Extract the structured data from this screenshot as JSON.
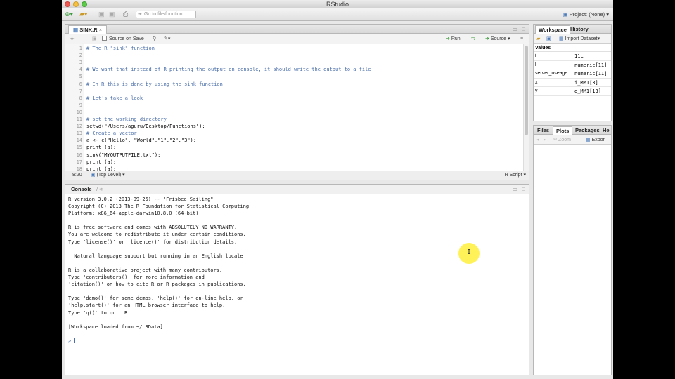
{
  "app": {
    "title": "RStudio",
    "goto_placeholder": "Go to file/function",
    "project_label": "Project: (None)"
  },
  "editor": {
    "tab_label": "SINK.R",
    "source_on_save": "Source on Save",
    "run_label": "Run",
    "source_label": "Source",
    "cursor_pos": "8:20",
    "scope": "(Top Level)",
    "filetype": "R Script",
    "lines": [
      {
        "n": "1",
        "text": "# The R \"sink\" function",
        "kind": "comment"
      },
      {
        "n": "2",
        "text": "",
        "kind": "code"
      },
      {
        "n": "3",
        "text": "",
        "kind": "code"
      },
      {
        "n": "4",
        "text": "# We want that instead of R printing the output on console, it should write the output to a file",
        "kind": "comment"
      },
      {
        "n": "5",
        "text": "",
        "kind": "code"
      },
      {
        "n": "6",
        "text": "# In R this is done by using the sink function",
        "kind": "comment"
      },
      {
        "n": "7",
        "text": "",
        "kind": "code"
      },
      {
        "n": "8",
        "text": "# Let's take a look",
        "kind": "comment",
        "cursor": true
      },
      {
        "n": "9",
        "text": "",
        "kind": "code"
      },
      {
        "n": "10",
        "text": "",
        "kind": "code"
      },
      {
        "n": "11",
        "text": "# set the working directory",
        "kind": "comment"
      },
      {
        "n": "12",
        "text": "setwd(\"/Users/aguru/Desktop/Functions\");",
        "kind": "code"
      },
      {
        "n": "13",
        "text": "# Create a vector",
        "kind": "comment"
      },
      {
        "n": "14",
        "text": "a <- c(\"Hello\", \"World\",\"1\",\"2\",\"3\");",
        "kind": "code"
      },
      {
        "n": "15",
        "text": "print (a);",
        "kind": "code"
      },
      {
        "n": "16",
        "text": "sink(\"MYOUTPUTFILE.txt\");",
        "kind": "code"
      },
      {
        "n": "17",
        "text": "print (a);",
        "kind": "code"
      },
      {
        "n": "18",
        "text": "print (a);",
        "kind": "code"
      }
    ]
  },
  "console": {
    "tab_label": "Console",
    "path": "~/",
    "text": "R version 3.0.2 (2013-09-25) -- \"Frisbee Sailing\"\nCopyright (C) 2013 The R Foundation for Statistical Computing\nPlatform: x86_64-apple-darwin10.8.0 (64-bit)\n\nR is free software and comes with ABSOLUTELY NO WARRANTY.\nYou are welcome to redistribute it under certain conditions.\nType 'license()' or 'licence()' for distribution details.\n\n  Natural language support but running in an English locale\n\nR is a collaborative project with many contributors.\nType 'contributors()' for more information and\n'citation()' on how to cite R or R packages in publications.\n\nType 'demo()' for some demos, 'help()' for on-line help, or\n'help.start()' for an HTML browser interface to help.\nType 'q()' to quit R.\n\n[Workspace loaded from ~/.RData]\n",
    "prompt": ">"
  },
  "workspace": {
    "tabs": [
      "Workspace",
      "History"
    ],
    "import_label": "Import Dataset",
    "section": "Values",
    "rows": [
      {
        "name": "i",
        "value": "11L"
      },
      {
        "name": "l",
        "value": "numeric[11]"
      },
      {
        "name": "server_useage",
        "value": "numeric[11]"
      },
      {
        "name": "x",
        "value": "i_MM1[3]"
      },
      {
        "name": "y",
        "value": "o_MM1[13]"
      }
    ]
  },
  "files": {
    "tabs": [
      "Files",
      "Plots",
      "Packages",
      "He"
    ],
    "zoom_label": "Zoom",
    "export_label": "Expor"
  }
}
